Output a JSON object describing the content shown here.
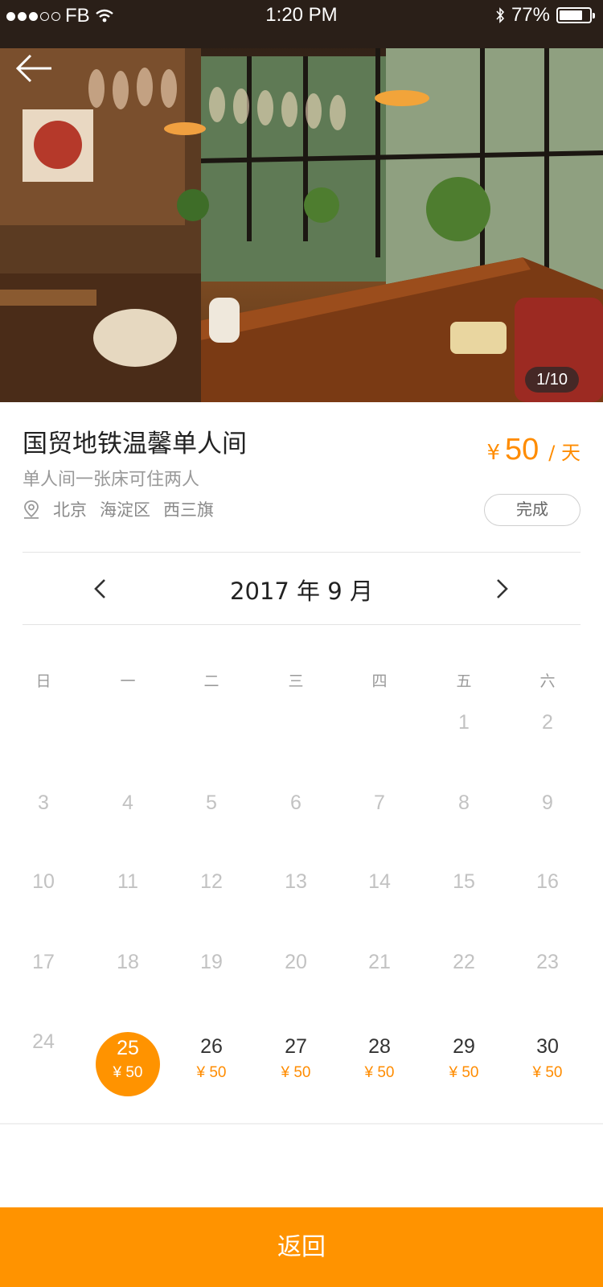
{
  "status_bar": {
    "carrier": "FB",
    "time": "1:20 PM",
    "battery": "77%",
    "battery_level": 0.77,
    "signal_bars": 3
  },
  "hero": {
    "image_counter": "1/10"
  },
  "listing": {
    "title": "国贸地铁温馨单人间",
    "subtitle": "单人间一张床可住两人",
    "location": [
      "北京",
      "海淀区",
      "西三旗"
    ],
    "price_symbol": "¥",
    "price_amount": "50",
    "price_unit": "/ 天",
    "done_label": "完成"
  },
  "calendar": {
    "month_label": "2017 年 9 月",
    "weekdays": [
      "日",
      "一",
      "二",
      "三",
      "四",
      "五",
      "六"
    ],
    "weeks": [
      [
        null,
        null,
        null,
        null,
        null,
        {
          "day": "1"
        },
        {
          "day": "2"
        }
      ],
      [
        {
          "day": "3"
        },
        {
          "day": "4"
        },
        {
          "day": "5"
        },
        {
          "day": "6"
        },
        {
          "day": "7"
        },
        {
          "day": "8"
        },
        {
          "day": "9"
        }
      ],
      [
        {
          "day": "10"
        },
        {
          "day": "11"
        },
        {
          "day": "12"
        },
        {
          "day": "13"
        },
        {
          "day": "14"
        },
        {
          "day": "15"
        },
        {
          "day": "16"
        }
      ],
      [
        {
          "day": "17"
        },
        {
          "day": "18"
        },
        {
          "day": "19"
        },
        {
          "day": "20"
        },
        {
          "day": "21"
        },
        {
          "day": "22"
        },
        {
          "day": "23"
        }
      ],
      [
        {
          "day": "24"
        },
        {
          "day": "25",
          "price": "¥ 50",
          "selected": true
        },
        {
          "day": "26",
          "price": "¥ 50"
        },
        {
          "day": "27",
          "price": "¥ 50"
        },
        {
          "day": "28",
          "price": "¥ 50"
        },
        {
          "day": "29",
          "price": "¥ 50"
        },
        {
          "day": "30",
          "price": "¥ 50"
        }
      ]
    ]
  },
  "footer": {
    "return_label": "返回"
  },
  "colors": {
    "accent": "#ff9300",
    "price_text": "#ff8c00",
    "disabled_day": "#c2c2c2"
  }
}
